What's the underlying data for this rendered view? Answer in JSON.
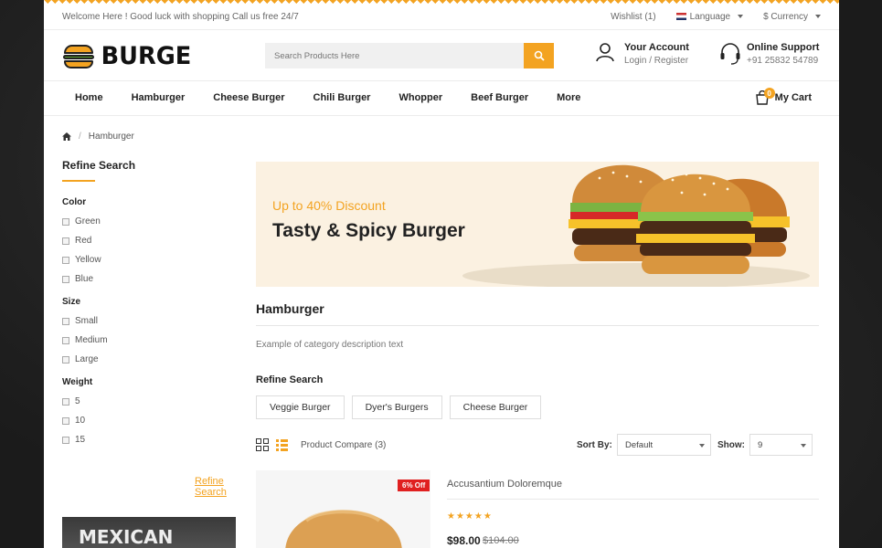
{
  "topbar": {
    "welcome": "Welcome Here ! Good luck with shopping Call us free 24/7",
    "wishlist": "Wishlist (1)",
    "language": "Language",
    "currency": "$ Currency"
  },
  "header": {
    "logo": "BURGE",
    "search_placeholder": "Search Products Here",
    "account_title": "Your Account",
    "account_sub": "Login / Register",
    "support_title": "Online Support",
    "support_phone": "+91 25832 54789"
  },
  "nav": {
    "items": [
      "Home",
      "Hamburger",
      "Cheese Burger",
      "Chili Burger",
      "Whopper",
      "Beef Burger",
      "More"
    ],
    "cart_label": "My Cart",
    "cart_count": "0"
  },
  "breadcrumb": {
    "current": "Hamburger"
  },
  "sidebar": {
    "title": "Refine Search",
    "color_title": "Color",
    "colors": [
      "Green",
      "Red",
      "Yellow",
      "Blue"
    ],
    "size_title": "Size",
    "sizes": [
      "Small",
      "Medium",
      "Large"
    ],
    "weight_title": "Weight",
    "weights": [
      "5",
      "10",
      "15"
    ],
    "refine_link": "Refine Search",
    "banner_text": "MEXICAN BURGER"
  },
  "banner": {
    "discount": "Up to 40% Discount",
    "tagline": "Tasty & Spicy Burger"
  },
  "category": {
    "title": "Hamburger",
    "description": "Example of category description text",
    "refine_title": "Refine Search",
    "subcategories": [
      "Veggie Burger",
      "Dyer's Burgers",
      "Cheese Burger"
    ]
  },
  "toolbar": {
    "compare": "Product Compare (3)",
    "sort_label": "Sort By:",
    "sort_value": "Default",
    "show_label": "Show:",
    "show_value": "9"
  },
  "product": {
    "badge": "6% Off",
    "name": "Accusantium Doloremque",
    "rating": "★★★★★",
    "price": "$98.00",
    "old_price": "$104.00"
  },
  "colors": {
    "accent": "#f3a321",
    "sale": "#e02020"
  }
}
